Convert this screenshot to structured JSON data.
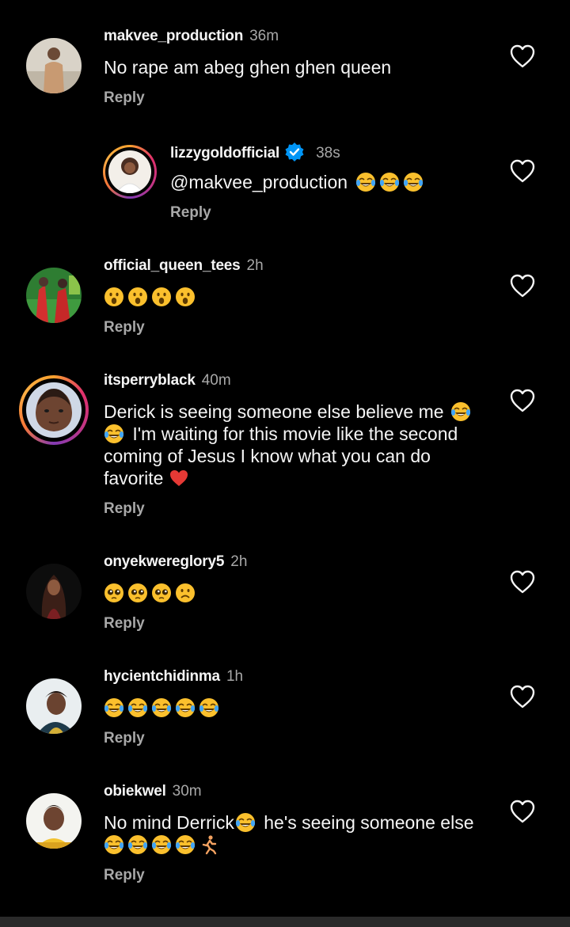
{
  "comments": [
    {
      "username": "makvee_production",
      "time": "36m",
      "text": "No rape am abeg ghen ghen queen",
      "reply_label": "Reply",
      "avatar_icon": "user-avatar-photo",
      "like_icon": "heart-outline-icon"
    },
    {
      "username": "lizzygoldofficial",
      "verified": true,
      "time": "38s",
      "text": "@makvee_production",
      "emojis": [
        "face-with-tears-of-joy",
        "face-with-tears-of-joy",
        "face-with-tears-of-joy"
      ],
      "reply_label": "Reply",
      "is_reply": true,
      "has_story_ring": true
    },
    {
      "username": "official_queen_tees",
      "time": "2h",
      "emojis": [
        "face-with-open-mouth",
        "face-with-open-mouth",
        "face-with-open-mouth",
        "face-with-open-mouth"
      ],
      "reply_label": "Reply"
    },
    {
      "username": "itsperryblack",
      "time": "40m",
      "text_lines": [
        "Derick is seeing someone else believe me",
        "I'm waiting for this movie like the second",
        "coming of Jesus I know what you can do",
        "favorite"
      ],
      "reply_label": "Reply",
      "has_story_ring": true
    },
    {
      "username": "onyekwereglory5",
      "time": "2h",
      "emojis": [
        "pleading-face",
        "pleading-face",
        "pleading-face",
        "frowning-face"
      ],
      "reply_label": "Reply"
    },
    {
      "username": "hycientchidinma",
      "time": "1h",
      "emojis": [
        "face-with-tears-of-joy",
        "face-with-tears-of-joy",
        "face-with-tears-of-joy",
        "face-with-tears-of-joy",
        "face-with-tears-of-joy"
      ],
      "reply_label": "Reply"
    },
    {
      "username": "obiekwel",
      "time": "30m",
      "text_line1_a": "No mind Derrick",
      "text_line1_b": "he's seeing someone else",
      "reply_label": "Reply"
    }
  ],
  "colors": {
    "background": "#000000",
    "text": "#f5f5f5",
    "muted": "#a8a8a8",
    "verified_blue": "#0095f6"
  }
}
